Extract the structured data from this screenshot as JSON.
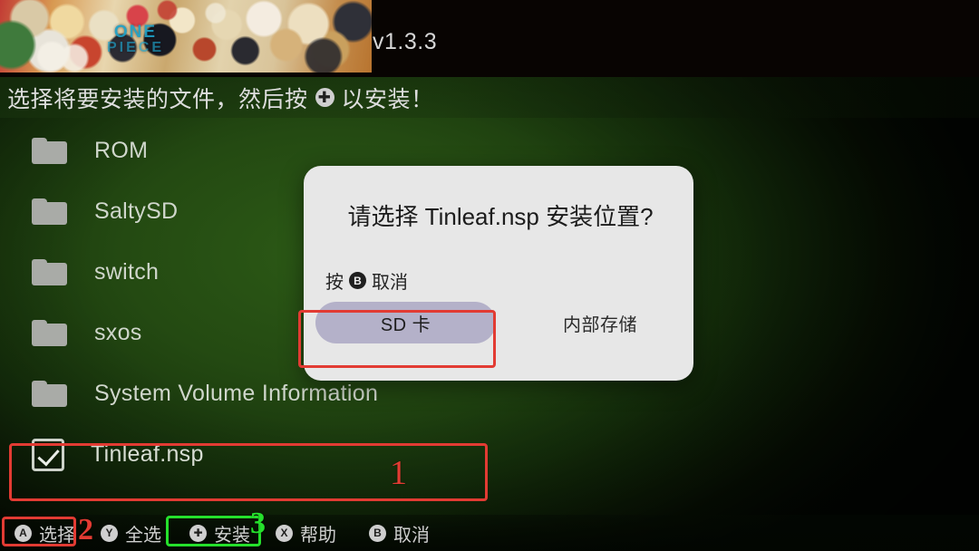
{
  "app": {
    "version": "v1.3.3",
    "banner_title_line1": "ONE",
    "banner_title_line2": "PIECE"
  },
  "instruction": {
    "text_before": "选择将要安装的文件，然后按",
    "button_glyph": "✚",
    "text_after": "以安装！"
  },
  "file_list": [
    {
      "name": "ROM",
      "icon": "folder-icon",
      "type": "folder",
      "checked": false
    },
    {
      "name": "SaltySD",
      "icon": "folder-icon",
      "type": "folder",
      "checked": false
    },
    {
      "name": "switch",
      "icon": "folder-icon",
      "type": "folder",
      "checked": false
    },
    {
      "name": "sxos",
      "icon": "folder-icon",
      "type": "folder",
      "checked": false
    },
    {
      "name": "System Volume Information",
      "icon": "folder-icon",
      "type": "folder",
      "checked": false
    },
    {
      "name": "Tinleaf.nsp",
      "icon": "checkbox-checked-icon",
      "type": "file",
      "checked": true
    }
  ],
  "dialog": {
    "title": "请选择 Tinleaf.nsp 安装位置?",
    "hint_before": "按",
    "hint_glyph": "B",
    "hint_after": "取消",
    "sd_card_label": "SD 卡",
    "internal_storage_label": "内部存储"
  },
  "bottom_bar": [
    {
      "glyph": "A",
      "label": "选择"
    },
    {
      "glyph": "Y",
      "label": "全选"
    },
    {
      "glyph": "✚",
      "label": "安装"
    },
    {
      "glyph": "X",
      "label": "帮助"
    },
    {
      "glyph": "B",
      "label": "取消"
    }
  ],
  "annotations": {
    "step_1": "1",
    "step_2": "2",
    "step_3": "3"
  },
  "colors": {
    "background_green": "#2c5a16",
    "dialog_surface": "#e7e7e7",
    "sd_button": "#b4b1c9",
    "annotation_red": "#e23b33",
    "annotation_green": "#25e02c",
    "text_light": "#cfd6cb"
  }
}
